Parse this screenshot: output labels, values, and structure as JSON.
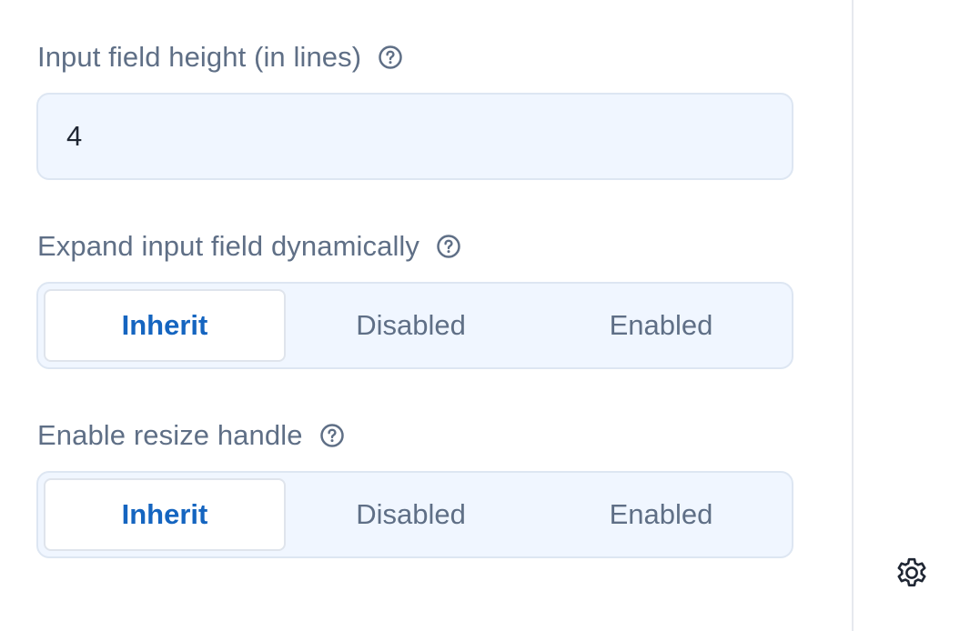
{
  "fields": {
    "height": {
      "label": "Input field height (in lines)",
      "help_icon": "help-circle-icon",
      "value": "4"
    },
    "expand": {
      "label": "Expand input field dynamically",
      "help_icon": "help-circle-icon",
      "options": [
        "Inherit",
        "Disabled",
        "Enabled"
      ],
      "selected": "Inherit"
    },
    "resize": {
      "label": "Enable resize handle",
      "help_icon": "help-circle-icon",
      "options": [
        "Inherit",
        "Disabled",
        "Enabled"
      ],
      "selected": "Inherit"
    }
  },
  "sidebar": {
    "settings_icon": "gear-icon"
  },
  "colors": {
    "label": "#5f6f86",
    "field_bg": "#f0f6ff",
    "field_border": "#dde6f2",
    "active_text": "#1565c0",
    "divider": "#e6e9ee"
  }
}
